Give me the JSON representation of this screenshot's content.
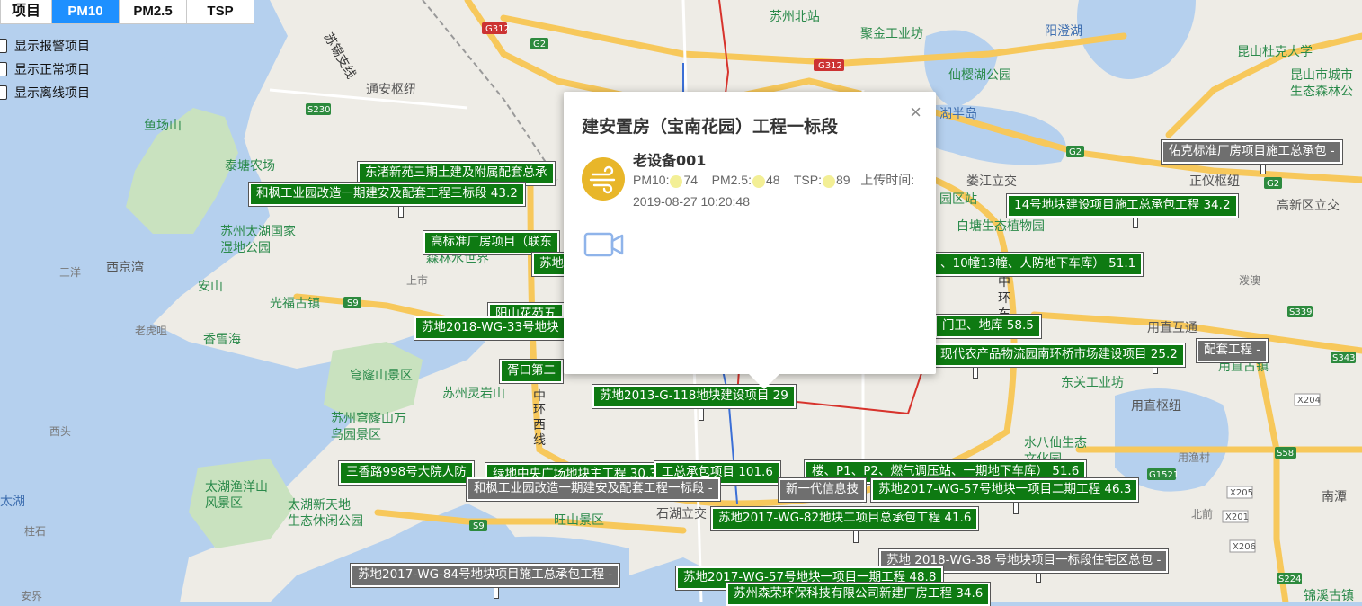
{
  "tabs": {
    "label": "项目",
    "items": [
      "PM10",
      "PM2.5",
      "TSP"
    ],
    "active_index": 0
  },
  "filters": [
    "显示报警项目",
    "显示正常项目",
    "显示离线项目"
  ],
  "colors": {
    "normal_marker": "#0e7a12",
    "offline_marker": "#6f6f6f",
    "active_tab": "#1e90ff",
    "device_icon": "#e8b629",
    "aqi_dot": "#f3ef96"
  },
  "map_labels": {
    "place_names": [
      "苏州北站",
      "聚金工业坊",
      "阳澄湖",
      "昆山杜克大学",
      "昆山市城市生态森林公园",
      "仙樱湖公园",
      "湖半岛",
      "娄江立交",
      "正仪枢纽",
      "高新区立交",
      "鱼场山",
      "泰塘农场",
      "通安枢纽",
      "苏州太湖国家湿地公园",
      "西京湾",
      "安山",
      "光福古镇",
      "三洋",
      "香雪海",
      "老虎咀",
      "苏州森林水世界",
      "上市",
      "穹窿山景区",
      "苏州灵岩山",
      "苏州穹窿山万鸟园景区",
      "西头",
      "太湖",
      "太湖渔洋山风景区",
      "太湖新天地生态休闲公园",
      "柱石",
      "旺山景区",
      "石湖立交",
      "白塘生态植物园",
      "苏州乐园",
      "用直互通",
      "用直古镇",
      "用直枢纽",
      "东关工业坊",
      "水八仙生态文化园",
      "用渔村",
      "南潭",
      "北前",
      "锦溪古镇",
      "安界",
      "泼澳",
      "中环西线",
      "中环东线",
      "苏锡支线",
      "G2",
      "G312",
      "S230",
      "S9",
      "G1521",
      "S339",
      "S343",
      "X204",
      "X205",
      "X201",
      "X206",
      "S224",
      "S58"
    ]
  },
  "markers": [
    {
      "text": "东渚新苑三期土建及附属配套总承",
      "type": "normal"
    },
    {
      "text": "和枫工业园改造一期建安及配套工程三标段 43.2",
      "type": "normal"
    },
    {
      "text": "高标准厂房项目（联东",
      "type": "normal"
    },
    {
      "text": "苏地",
      "type": "normal"
    },
    {
      "text": "阳山花苑五",
      "type": "normal"
    },
    {
      "text": "苏地2018-WG-33号地块",
      "type": "normal"
    },
    {
      "text": "胥口第二",
      "type": "normal"
    },
    {
      "text": "苏地2013-G-118地块建设项目 29",
      "type": "normal"
    },
    {
      "text": "三香路998号大院人防",
      "type": "normal"
    },
    {
      "text": "绿地中央广场地块主工程 30.3",
      "type": "normal"
    },
    {
      "text": "工总承包项目 101.6",
      "type": "normal"
    },
    {
      "text": "楼、P1、P2、燃气调压站、一期地下车库） 51.6",
      "type": "normal"
    },
    {
      "text": "和枫工业园改造一期建安及配套工程一标段 -",
      "type": "offline"
    },
    {
      "text": "新一代信息技",
      "type": "offline"
    },
    {
      "text": "苏地2017-WG-57号地块一项目二期工程 46.3",
      "type": "normal"
    },
    {
      "text": "苏地2017-WG-82地块二项目总承包工程 41.6",
      "type": "normal"
    },
    {
      "text": "苏地 2018-WG-38 号地块项目一标段住宅区总包 -",
      "type": "offline"
    },
    {
      "text": "苏地2017-WG-84号地块项目施工总承包工程 -",
      "type": "offline"
    },
    {
      "text": "苏地2017-WG-57号地块一项目一期工程 48.8",
      "type": "normal"
    },
    {
      "text": "苏州森荣环保科技有限公司新建厂房工程 34.6",
      "type": "normal"
    },
    {
      "text": "佑克标准厂房项目施工总承包 -",
      "type": "offline"
    },
    {
      "text": "14号地块建设项目施工总承包工程 34.2",
      "type": "normal"
    },
    {
      "text": "、10幢13幢、人防地下车库） 51.1",
      "type": "normal"
    },
    {
      "text": "现代农产品物流园南环桥市场建设项目 25.2",
      "type": "normal"
    },
    {
      "text": "配套工程 -",
      "type": "offline"
    },
    {
      "text": "门卫、地库 58.5",
      "type": "normal"
    }
  ],
  "popup": {
    "title": "建安置房（宝南花园）工程一标段",
    "close": "×",
    "device_name": "老设备001",
    "pm10_label": "PM10:",
    "pm10_value": "74",
    "pm25_label": "PM2.5:",
    "pm25_value": "48",
    "tsp_label": "TSP:",
    "tsp_value": "89",
    "upload_label": "上传时间:",
    "upload_time": "2019-08-27 10:20:48",
    "device_icon": "wind-icon",
    "camera_icon": "video-camera-icon"
  }
}
